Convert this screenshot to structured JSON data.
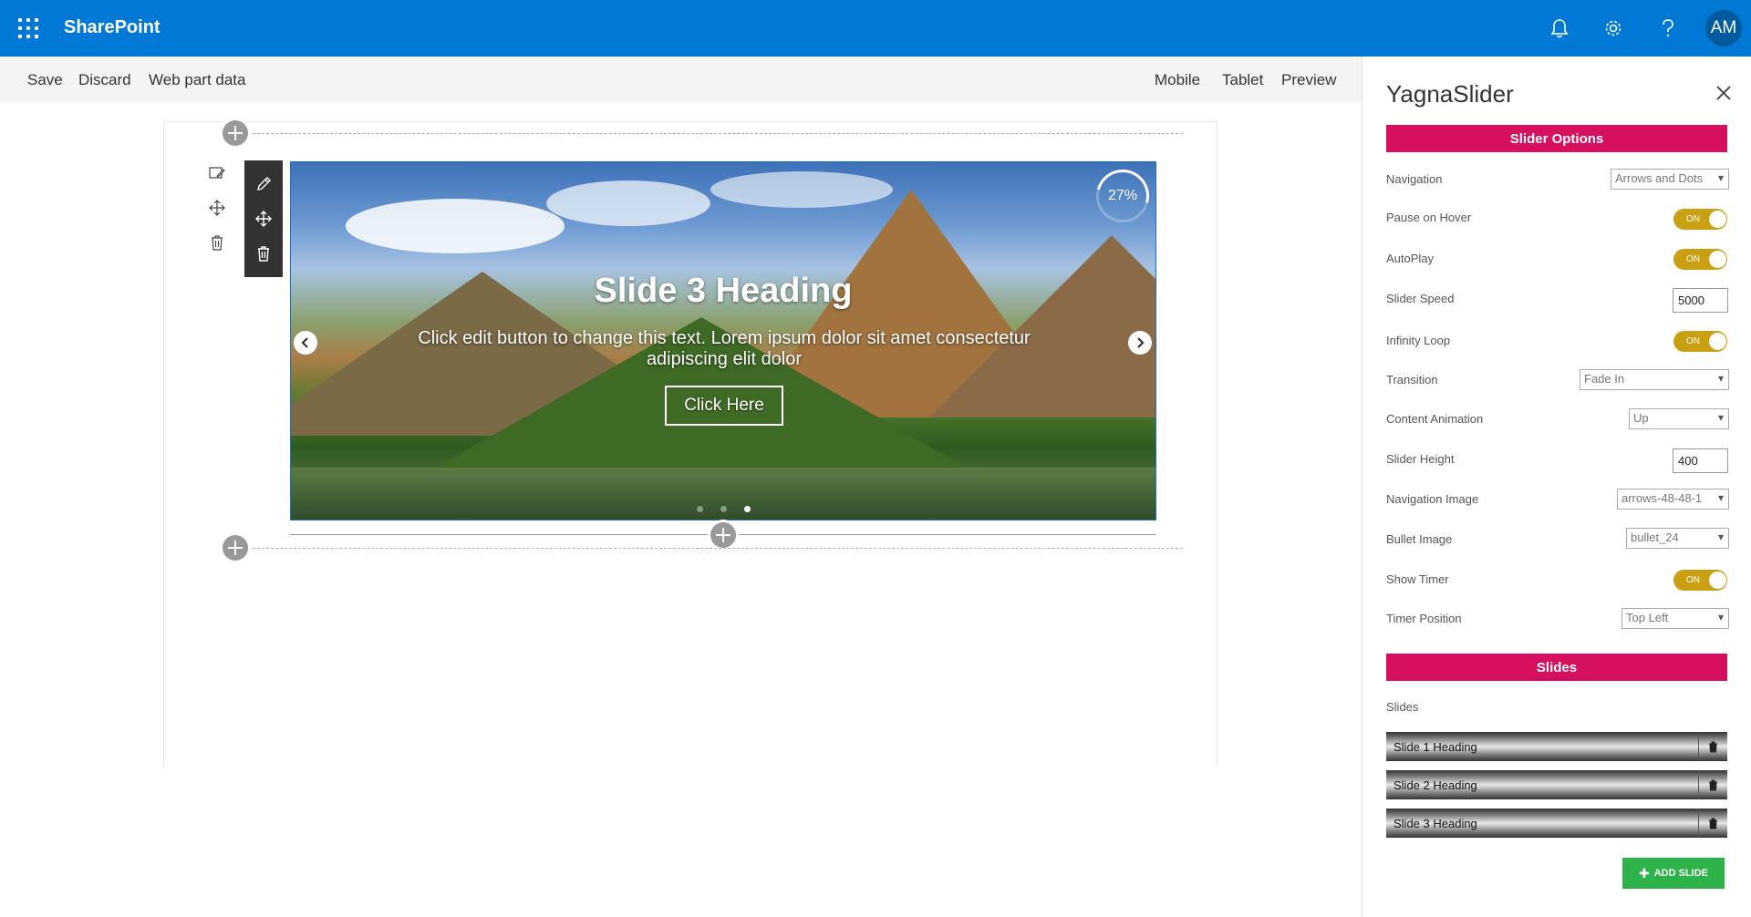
{
  "suite": {
    "app_name": "SharePoint",
    "avatar_initials": "AM",
    "icons": [
      "waffle-icon",
      "bell-icon",
      "gear-icon",
      "help-icon"
    ]
  },
  "command_bar": {
    "save": "Save",
    "discard": "Discard",
    "web_part_data": "Web part data",
    "mobile": "Mobile",
    "tablet": "Tablet",
    "preview": "Preview"
  },
  "slider": {
    "heading": "Slide 3 Heading",
    "text": "Click edit button to change this text. Lorem ipsum dolor sit amet consectetur adipiscing elit dolor",
    "button_label": "Click Here",
    "timer_text": "27%",
    "slide_count": 3,
    "active_dot": 3
  },
  "pane": {
    "title": "YagnaSlider",
    "slider_options_header": "Slider Options",
    "navigation_label": "Navigation",
    "navigation_value": "Arrows and Dots",
    "pause_on_hover_label": "Pause on Hover",
    "pause_on_hover_value": "ON",
    "autoplay_label": "AutoPlay",
    "autoplay_value": "ON",
    "slider_speed_label": "Slider Speed",
    "slider_speed_value": "5000",
    "infinity_loop_label": "Infinity Loop",
    "infinity_loop_value": "ON",
    "transition_label": "Transition",
    "transition_value": "Fade In",
    "content_animation_label": "Content Animation",
    "content_animation_value": "Up",
    "slider_height_label": "Slider Height",
    "slider_height_value": "400",
    "navigation_image_label": "Navigation Image",
    "navigation_image_value": "arrows-48-48-1",
    "bullet_image_label": "Bullet Image",
    "bullet_image_value": "bullet_24",
    "show_timer_label": "Show Timer",
    "show_timer_value": "ON",
    "timer_position_label": "Timer Position",
    "timer_position_value": "Top Left",
    "slides_header": "Slides",
    "slides_label": "Slides",
    "slides": [
      {
        "label": "Slide 1 Heading"
      },
      {
        "label": "Slide 2 Heading"
      },
      {
        "label": "Slide 3 Heading"
      }
    ],
    "add_slide_label": "ADD SLIDE"
  },
  "colors": {
    "suite_blue": "#0078d4",
    "section_pink": "#d60f5f",
    "toggle_on": "#c9a012",
    "add_green": "#2db34a"
  }
}
